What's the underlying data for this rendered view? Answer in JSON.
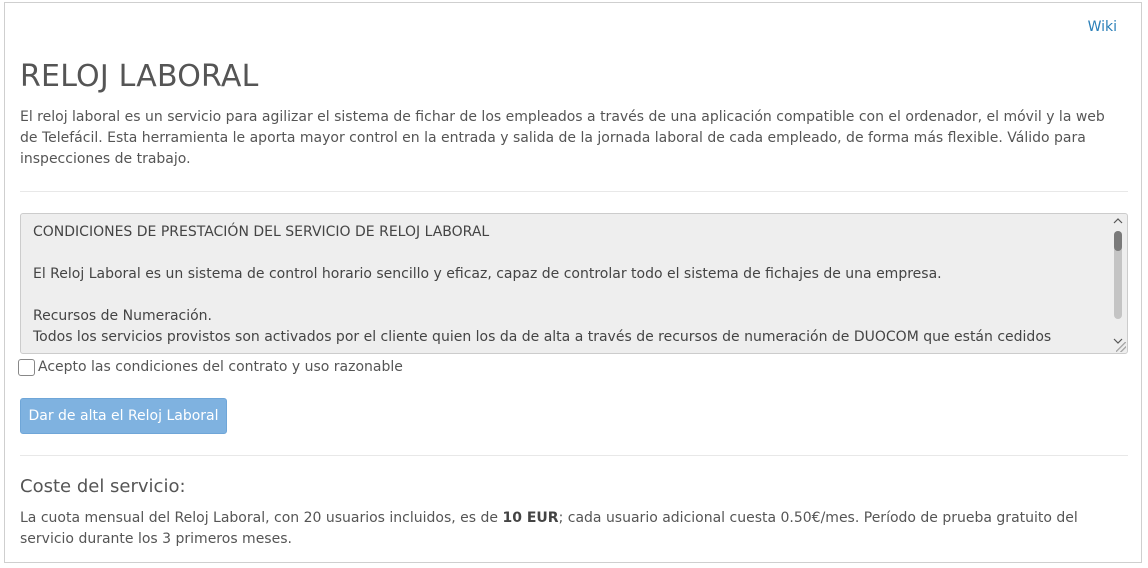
{
  "header": {
    "wiki_link": "Wiki",
    "title": "RELOJ LABORAL"
  },
  "intro": {
    "text": "El reloj laboral es un servicio para agilizar el sistema de fichar de los empleados a través de una aplicación compatible con el ordenador, el móvil y la web de Telefácil. Esta herramienta le aporta mayor control en la entrada y salida de la jornada laboral de cada empleado, de forma más flexible. Válido para inspecciones de trabajo."
  },
  "terms": {
    "heading": "CONDICIONES DE PRESTACIÓN DEL SERVICIO DE RELOJ LABORAL",
    "paragraph_1": "El Reloj Laboral es un sistema de control horario sencillo y eficaz, capaz de controlar todo el sistema de fichajes de una empresa.",
    "section_title": "Recursos de Numeración.",
    "paragraph_2": "Todos los servicios provistos son activados por el cliente quien los da de alta a través de recursos de numeración de DUOCOM que están cedidos"
  },
  "accept": {
    "label": "Acepto las condiciones del contrato y uso razonable",
    "checked": false
  },
  "submit": {
    "label": "Dar de alta el Reloj Laboral"
  },
  "cost": {
    "heading": "Coste del servicio:",
    "text_before": "La cuota mensual del Reloj Laboral, con 20 usuarios incluidos, es de ",
    "price": "10 EUR",
    "text_after": "; cada usuario adicional cuesta 0.50€/mes. Período de prueba gratuito del servicio durante los 3 primeros meses."
  },
  "colors": {
    "link": "#2a7fb8",
    "button": "#7fb2e0",
    "text": "#555555",
    "terms_background": "#eeeeee"
  },
  "icons": {
    "scroll_up": "chevron-up-icon",
    "scroll_down": "chevron-down-icon",
    "resize": "resize-grip-icon"
  }
}
